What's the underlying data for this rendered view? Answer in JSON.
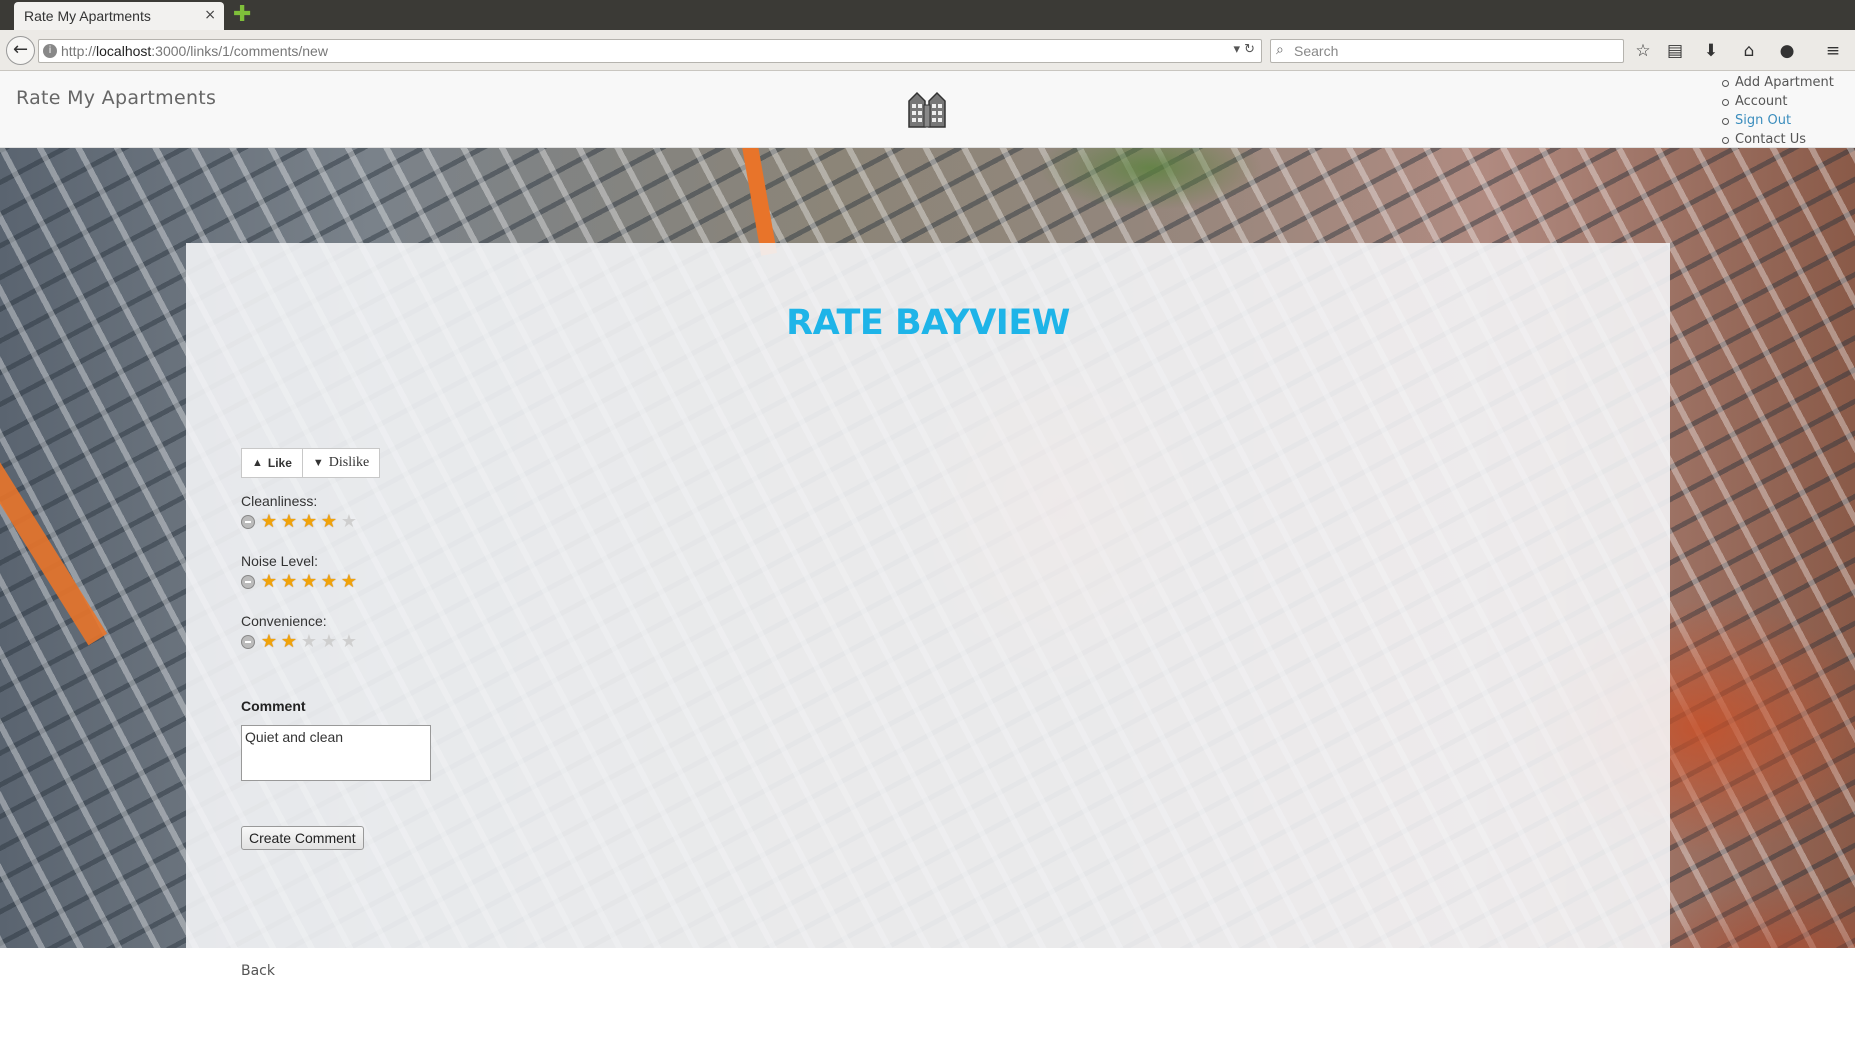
{
  "browser": {
    "tab_title": "Rate My Apartments",
    "tab_close": "×",
    "new_tab": "✚",
    "url_scheme": "http://",
    "url_host": "localhost",
    "url_rest": ":3000/links/1/comments/new",
    "url_tools": "▾  ↻",
    "search_placeholder": "Search"
  },
  "site": {
    "brand": "Rate My Apartments",
    "nav": [
      "Add Apartment",
      "Account",
      "Sign Out",
      "Contact Us"
    ],
    "active_nav": "Sign Out"
  },
  "form": {
    "title": "RATE BAYVIEW",
    "like_label": "Like",
    "dislike_label": "Dislike",
    "ratings": [
      {
        "label": "Cleanliness:",
        "stars": 4,
        "max": 5
      },
      {
        "label": "Noise Level:",
        "stars": 5,
        "max": 5
      },
      {
        "label": "Convenience:",
        "stars": 2,
        "max": 5
      }
    ],
    "comment_label": "Comment",
    "comment_value": "Quiet and clean",
    "submit_label": "Create Comment"
  },
  "footer": {
    "back_label": "Back"
  },
  "colors": {
    "title": "#1eb4e8",
    "star_on": "#f0a30a",
    "active_link": "#3b8dbd"
  }
}
